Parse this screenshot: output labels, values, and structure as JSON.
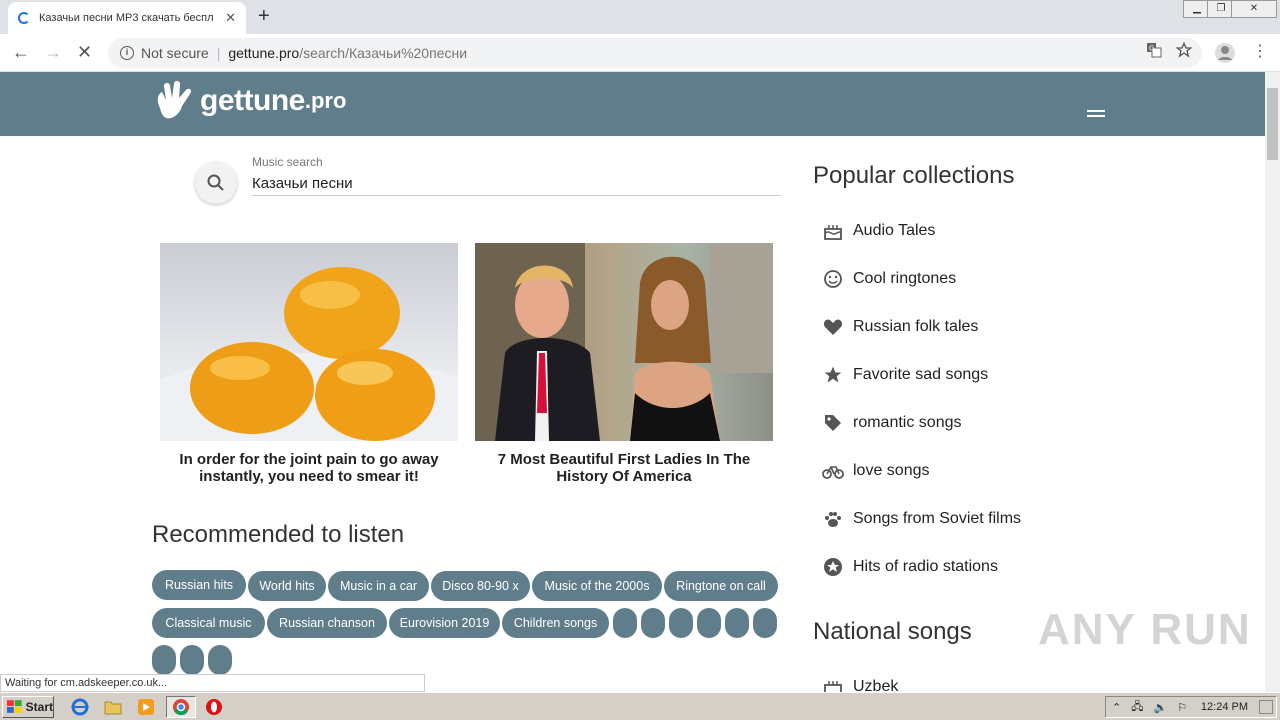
{
  "browser": {
    "tab_title": "Казачьи песни MP3 скачать беспл",
    "tab_close": "✕",
    "new_tab": "+",
    "not_secure": "Not secure",
    "url_domain": "gettune.pro",
    "url_path": "/search/Казачьи%20песни",
    "status_text": "Waiting for cm.adskeeper.co.uk..."
  },
  "header": {
    "brand": "gettune",
    "tld": ".pro"
  },
  "search": {
    "label": "Music search",
    "value": "Казачьи песни"
  },
  "ads": [
    {
      "caption": "In order for the joint pain to go away instantly, you need to smear it!"
    },
    {
      "caption": "7 Most Beautiful First Ladies In The History Of America"
    }
  ],
  "recommended": {
    "title": "Recommended to listen",
    "chips": [
      "Russian hits",
      "World hits",
      "Music in a car",
      "Disco 80-90 x",
      "Music of the 2000s",
      "Ringtone on call",
      "Classical music",
      "Russian chanson",
      "Eurovision 2019",
      "Children songs"
    ]
  },
  "sidebar": {
    "popular_title": "Popular collections",
    "collections": [
      {
        "label": "Audio Tales",
        "icon": "cake-icon"
      },
      {
        "label": "Cool ringtones",
        "icon": "smiley-icon"
      },
      {
        "label": "Russian folk tales",
        "icon": "heart-icon"
      },
      {
        "label": "Favorite sad songs",
        "icon": "star-icon"
      },
      {
        "label": "romantic songs",
        "icon": "tag-icon"
      },
      {
        "label": "love songs",
        "icon": "bicycle-icon"
      },
      {
        "label": "Songs from Soviet films",
        "icon": "paw-icon"
      },
      {
        "label": "Hits of radio stations",
        "icon": "star-circle-icon"
      }
    ],
    "national_title": "National songs",
    "national": [
      {
        "label": "Uzbek",
        "icon": "cake-icon"
      }
    ]
  },
  "taskbar": {
    "start": "Start",
    "clock": "12:24 PM"
  },
  "watermark": "ANY RUN",
  "colors": {
    "header": "#607d8b",
    "chip": "#607d8b"
  }
}
